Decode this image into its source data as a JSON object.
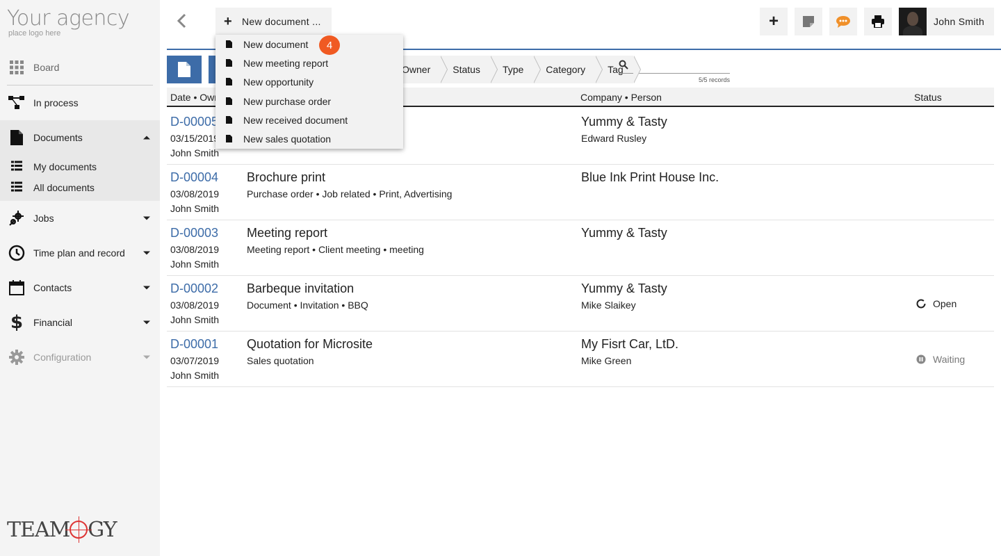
{
  "brand": {
    "title": "Your agency",
    "subtitle": "place logo here",
    "footer_logo_left": "TEAM",
    "footer_logo_right": "GY"
  },
  "sidebar": {
    "items": [
      {
        "label": "Board",
        "icon": "grid-icon"
      },
      {
        "label": "In process",
        "icon": "flow-icon"
      },
      {
        "label": "Documents",
        "icon": "document-icon"
      },
      {
        "label": "Jobs",
        "icon": "gears-icon"
      },
      {
        "label": "Time plan and record",
        "icon": "clock-icon"
      },
      {
        "label": "Contacts",
        "icon": "calendar-icon"
      },
      {
        "label": "Financial",
        "icon": "dollar-icon"
      },
      {
        "label": "Configuration",
        "icon": "gear-icon"
      }
    ],
    "documents_sub": [
      {
        "label": "My documents",
        "icon": "list-icon"
      },
      {
        "label": "All documents",
        "icon": "list-icon"
      }
    ]
  },
  "toolbar": {
    "new_document_label": "New document ...",
    "user_name": "John Smith",
    "accent_color": "#f05a22"
  },
  "dropdown": {
    "badge_count": "4",
    "items": [
      "New document",
      "New meeting report",
      "New opportunity",
      "New purchase order",
      "New received document",
      "New sales quotation"
    ]
  },
  "filters": {
    "crumbs": [
      "Owner",
      "Status",
      "Type",
      "Category",
      "Tag"
    ],
    "records": "5/5 records"
  },
  "table": {
    "headers": {
      "date_owner": "Date • Owner",
      "company_person": "Company • Person",
      "status": "Status"
    },
    "rows": [
      {
        "code": "D-00005",
        "date": "03/15/2019",
        "owner": "John Smith",
        "title": "",
        "meta": "",
        "company": "Yummy & Tasty",
        "person": "Edward Rusley",
        "status": ""
      },
      {
        "code": "D-00004",
        "date": "03/08/2019",
        "owner": "John Smith",
        "title": "Brochure print",
        "meta": "Purchase order • Job related • Print, Advertising",
        "company": "Blue Ink Print House Inc.",
        "person": "",
        "status": ""
      },
      {
        "code": "D-00003",
        "date": "03/08/2019",
        "owner": "John Smith",
        "title": "Meeting report",
        "meta": "Meeting report • Client meeting • meeting",
        "company": "Yummy & Tasty",
        "person": "",
        "status": ""
      },
      {
        "code": "D-00002",
        "date": "03/08/2019",
        "owner": "John Smith",
        "title": "Barbeque invitation",
        "meta": "Document • Invitation • BBQ",
        "company": "Yummy & Tasty",
        "person": "Mike Slaikey",
        "status": "Open"
      },
      {
        "code": "D-00001",
        "date": "03/07/2019",
        "owner": "John Smith",
        "title": "Quotation for Microsite",
        "meta": "Sales quotation",
        "company": "My Fisrt Car, LtD.",
        "person": "Mike Green",
        "status": "Waiting"
      }
    ]
  }
}
